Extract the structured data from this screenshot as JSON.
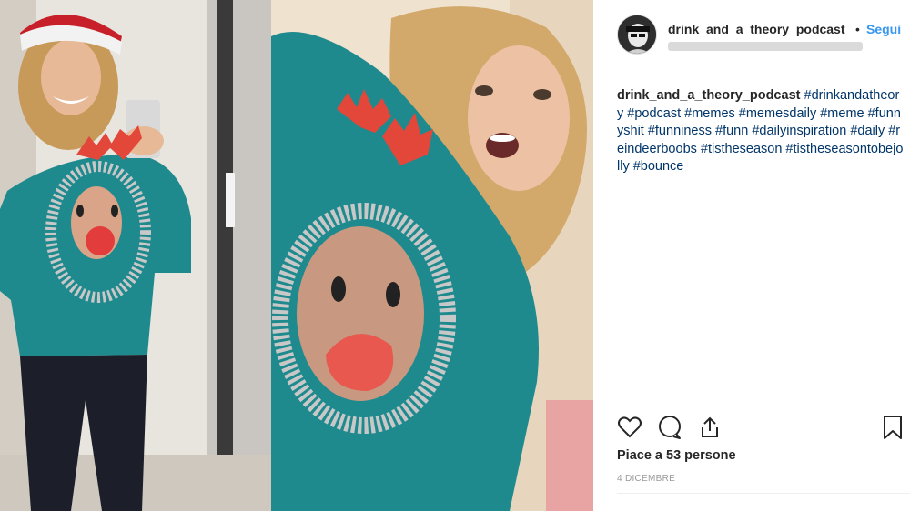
{
  "post": {
    "username": "drink_and_a_theory_podcast",
    "follow_separator": "•",
    "follow_label": "Segui",
    "caption_username": "drink_and_a_theory_podcast",
    "caption_hashtags": "#drinkandatheory #podcast #memes #memesdaily #meme #funnyshit #funniness #funn #dailyinspiration #daily #reindeerboobs #tistheseason #tistheseasontobejolly #bounce",
    "likes_text": "Piace a 53 persone",
    "date_text": "4 DICEMBRE"
  },
  "icons": {
    "like": "heart-icon",
    "comment": "comment-icon",
    "share": "share-icon",
    "save": "bookmark-icon"
  },
  "colors": {
    "link": "#003569",
    "follow": "#3897f0",
    "text": "#262626",
    "muted": "#999999",
    "sweater": "#1f8a8e"
  }
}
